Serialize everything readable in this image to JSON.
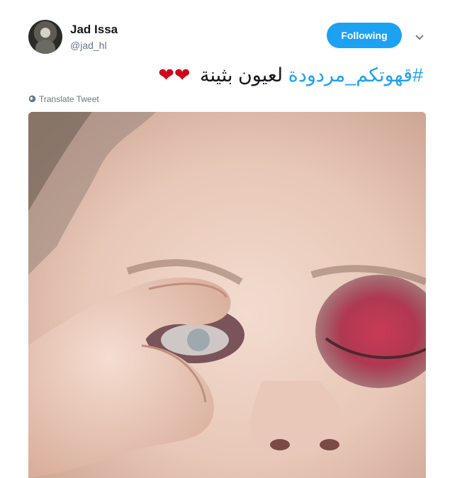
{
  "author": {
    "display_name": "Jad Issa",
    "handle": "@jad_hl"
  },
  "follow_button": {
    "label": "Following"
  },
  "tweet": {
    "hashtag": "#قهوتكم_مردودة",
    "text": "لعيون بثينة",
    "hearts": "❤❤"
  },
  "translate": {
    "label": "Translate Tweet"
  },
  "colors": {
    "accent": "#1da1f2",
    "heart": "#d0021b",
    "secondary_text": "#657786"
  },
  "icons": {
    "menu": "chevron-down-icon",
    "translate": "globe-icon"
  }
}
